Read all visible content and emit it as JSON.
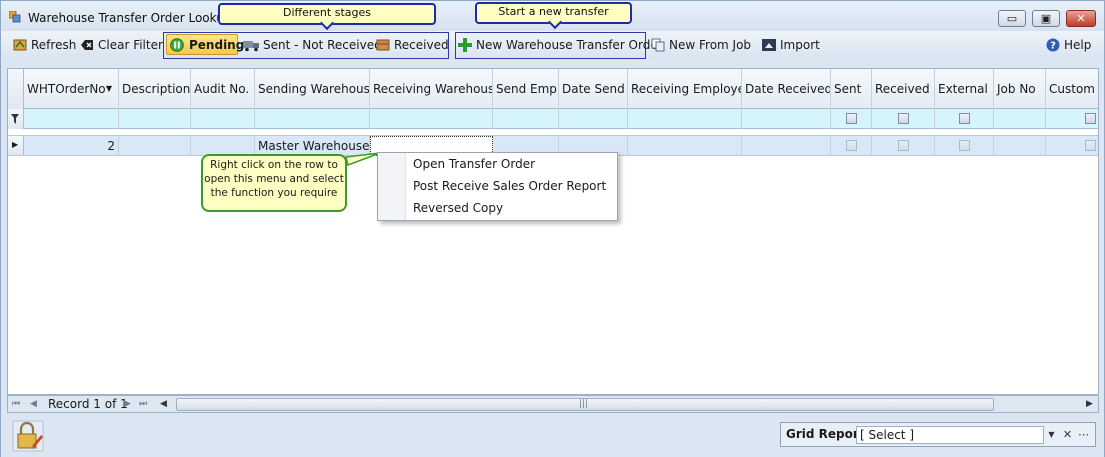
{
  "window": {
    "title": "Warehouse Transfer Order Lookup",
    "minimize_glyph": "▭",
    "maximize_glyph": "▣",
    "close_glyph": "✕"
  },
  "callouts": {
    "stages": "Different stages",
    "new_transfer": "Start a new transfer",
    "right_click": "Right click on the row to open this menu and select the function you require"
  },
  "toolbar": {
    "refresh": "Refresh",
    "clear_filter": "Clear Filter",
    "pending": "Pending",
    "sent_not_received": "Sent - Not Received",
    "received": "Received",
    "new_transfer": "New Warehouse Transfer Order",
    "new_from_job": "New From Job",
    "import": "Import",
    "help": "Help"
  },
  "grid": {
    "columns": [
      "WHTOrderNo",
      "Description",
      "Audit No.",
      "Sending Warehouse",
      "Receiving Warehouse",
      "Send Emp",
      "Date Send",
      "Receiving Employee",
      "Date Received",
      "Sent",
      "Received",
      "External",
      "Job No",
      "Custom Bo"
    ],
    "rows": [
      {
        "order_no": "2",
        "description": "",
        "audit_no": "",
        "sending_warehouse": "Master Warehouse",
        "receiving_warehouse": ""
      }
    ]
  },
  "context_menu": {
    "items": [
      "Open Transfer Order",
      "Post Receive Sales Order Report",
      "Reversed Copy"
    ]
  },
  "navigator": {
    "record_text": "Record 1 of 1"
  },
  "grid_report": {
    "label": "Grid Report:",
    "selected": "[ Select ]"
  },
  "colors": {
    "accent_blue": "#1b2ca6",
    "note_green": "#3f9a2e",
    "callout_bg": "#ffffc4",
    "filter_row": "#d6f4fb"
  }
}
